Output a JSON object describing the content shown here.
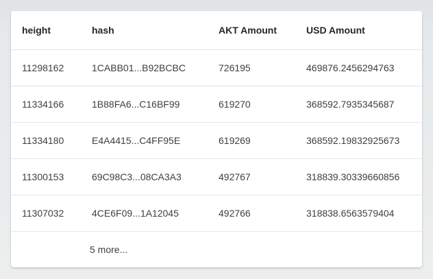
{
  "table": {
    "columns": [
      "height",
      "hash",
      "AKT Amount",
      "USD Amount"
    ],
    "rows": [
      [
        "11298162",
        "1CABB01...B92BCBC",
        "726195",
        "469876.2456294763"
      ],
      [
        "11334166",
        "1B88FA6...C16BF99",
        "619270",
        "368592.7935345687"
      ],
      [
        "11334180",
        "E4A4415...C4FF95E",
        "619269",
        "368592.19832925673"
      ],
      [
        "11300153",
        "69C98C3...08CA3A3",
        "492767",
        "318839.30339660856"
      ],
      [
        "11307032",
        "4CE6F09...1A12045",
        "492766",
        "318838.6563579404"
      ]
    ],
    "more_label": "5 more..."
  }
}
